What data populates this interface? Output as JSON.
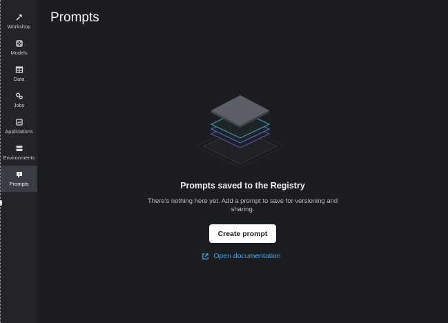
{
  "sidebar": {
    "items": [
      {
        "label": "Workshop",
        "icon": "workshop-icon"
      },
      {
        "label": "Models",
        "icon": "models-icon"
      },
      {
        "label": "Data",
        "icon": "table-icon"
      },
      {
        "label": "Jobs",
        "icon": "gears-icon"
      },
      {
        "label": "Applications",
        "icon": "application-icon"
      },
      {
        "label": "Environments",
        "icon": "server-icon"
      },
      {
        "label": "Prompts",
        "icon": "prompt-icon",
        "active": true
      }
    ]
  },
  "page": {
    "title": "Prompts"
  },
  "empty_state": {
    "illustration": "stacked-layers-illustration",
    "title": "Prompts saved to the Registry",
    "description": "There's nothing here yet. Add a prompt to save for versioning and sharing.",
    "create_button_label": "Create prompt",
    "doc_link_label": "Open documentation",
    "doc_link_icon": "external-link-icon"
  },
  "colors": {
    "background": "#1b1d21",
    "sidebar": "#222428",
    "active_nav": "#3a3d43",
    "link": "#3ba6e8",
    "button_bg": "#ffffff"
  }
}
